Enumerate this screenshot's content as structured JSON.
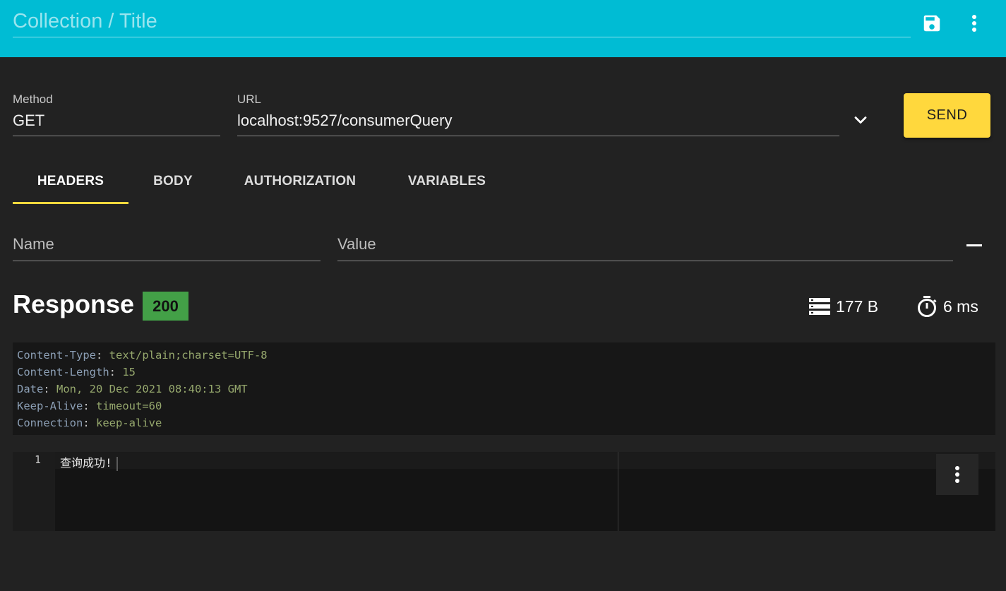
{
  "app": {
    "title_placeholder": "Collection / Title",
    "title_value": "",
    "accent_color": "#00BCD4",
    "send_color": "#FFD83D",
    "icons": {
      "save": "save-icon",
      "menu": "more-vert-icon"
    }
  },
  "request": {
    "method_label": "Method",
    "method_value": "GET",
    "url_label": "URL",
    "url_value": "localhost:9527/consumerQuery",
    "send_label": "SEND"
  },
  "tabs": [
    {
      "label": "HEADERS",
      "active": true
    },
    {
      "label": "BODY",
      "active": false
    },
    {
      "label": "AUTHORIZATION",
      "active": false
    },
    {
      "label": "VARIABLES",
      "active": false
    }
  ],
  "headers_form": {
    "name_placeholder": "Name",
    "value_placeholder": "Value"
  },
  "response": {
    "title": "Response",
    "status": "200",
    "status_color": "#43A047",
    "size": "177 B",
    "time": "6 ms",
    "headers": [
      {
        "key": "Content-Type",
        "value": "text/plain;charset=UTF-8"
      },
      {
        "key": "Content-Length",
        "value": "15"
      },
      {
        "key": "Date",
        "value": "Mon, 20 Dec 2021 08:40:13 GMT"
      },
      {
        "key": "Keep-Alive",
        "value": "timeout=60"
      },
      {
        "key": "Connection",
        "value": "keep-alive"
      }
    ],
    "body_lines": [
      {
        "number": "1",
        "text": "查询成功!"
      }
    ]
  }
}
